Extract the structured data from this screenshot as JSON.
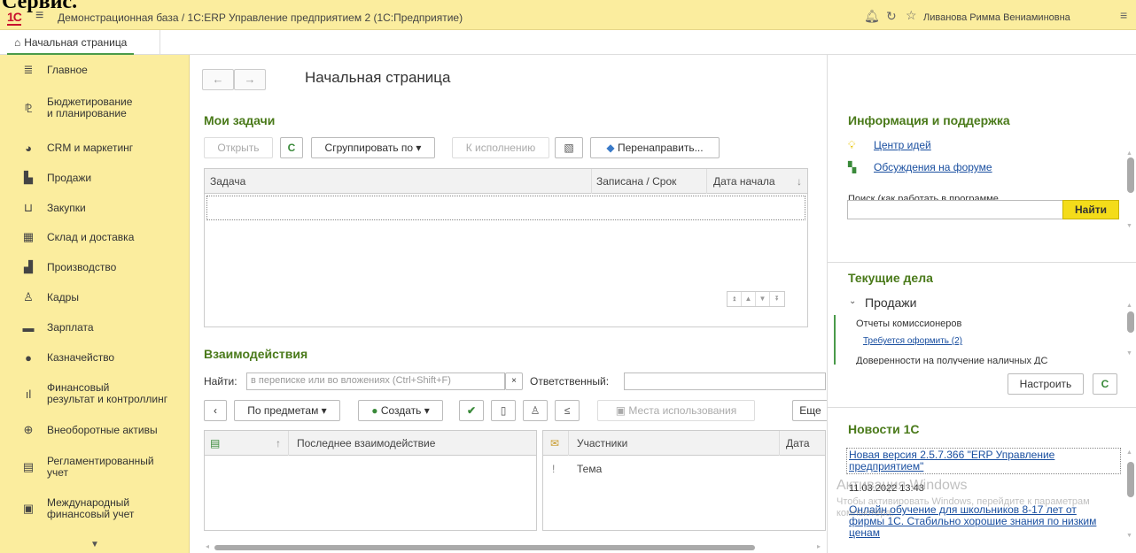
{
  "window": {
    "cropped_heading": "Сервис.",
    "logo_text": "1С",
    "title": "Демонстрационная база / 1С:ERP Управление предприятием 2  (1С:Предприятие)",
    "user": "Ливанова Римма Вениаминовна"
  },
  "tabs": [
    {
      "label": "Начальная страница"
    }
  ],
  "sidebar": {
    "items": [
      {
        "label": "Главное",
        "icon": "list-icon"
      },
      {
        "label": "Бюджетирование\nи планирование",
        "icon": "budget-icon"
      },
      {
        "label": "CRM и маркетинг",
        "icon": "pie-icon"
      },
      {
        "label": "Продажи",
        "icon": "bag-icon"
      },
      {
        "label": "Закупки",
        "icon": "cart-icon"
      },
      {
        "label": "Склад и доставка",
        "icon": "warehouse-icon"
      },
      {
        "label": "Производство",
        "icon": "factory-icon"
      },
      {
        "label": "Кадры",
        "icon": "person-icon"
      },
      {
        "label": "Зарплата",
        "icon": "wallet-icon"
      },
      {
        "label": "Казначейство",
        "icon": "coin-icon"
      },
      {
        "label": "Финансовый\nрезультат и контроллинг",
        "icon": "chart-icon"
      },
      {
        "label": "Внеоборотные активы",
        "icon": "assets-icon"
      },
      {
        "label": "Регламентированный\nучет",
        "icon": "ledger-icon"
      },
      {
        "label": "Международный\nфинансовый учет",
        "icon": "intl-icon"
      }
    ]
  },
  "main": {
    "title": "Начальная страница",
    "tasks": {
      "title": "Мои задачи",
      "buttons": {
        "open": "Открыть",
        "group": "Сгруппировать по",
        "execute": "К исполнению",
        "redirect": "Перенаправить..."
      },
      "columns": [
        "Задача",
        "Записана / Срок",
        "Дата начала"
      ]
    },
    "interactions": {
      "title": "Взаимодействия",
      "find_label": "Найти:",
      "find_placeholder": "в переписке или во вложениях (Ctrl+Shift+F)",
      "responsible_label": "Ответственный:",
      "buttons": {
        "by_subjects": "По предметам",
        "create": "Создать",
        "usage": "Места использования",
        "more": "Еще"
      },
      "left_columns": [
        "Последнее взаимодействие"
      ],
      "right_columns": [
        "Участники",
        "Дата"
      ],
      "right_subcolumn": "Тема"
    }
  },
  "right_panel": {
    "info": {
      "title": "Информация и поддержка",
      "links": [
        "Центр идей",
        "Обсуждения на форуме"
      ],
      "search_hint": "Поиск (как работать в программе,\nзаконодательство...)",
      "find_button": "Найти"
    },
    "current": {
      "title": "Текущие дела",
      "group": "Продажи",
      "item1": "Отчеты комиссионеров",
      "item1_link": "Требуется оформить (2)",
      "item2": "Доверенности на получение наличных ДС",
      "configure_button": "Настроить"
    },
    "news": {
      "title": "Новости 1С",
      "item1": "Новая версия 2.5.7.366 \"ERP Управление предприятием\"",
      "item1_date": "11.03.2022 13:43",
      "item2": "Онлайн обучение для школьников 8-17 лет от фирмы 1С. Стабильно хорошие знания по низким ценам"
    }
  },
  "watermark": {
    "title": "Активация Windows",
    "subtitle": "Чтобы активировать Windows, перейдите к параметрам компьютера."
  }
}
